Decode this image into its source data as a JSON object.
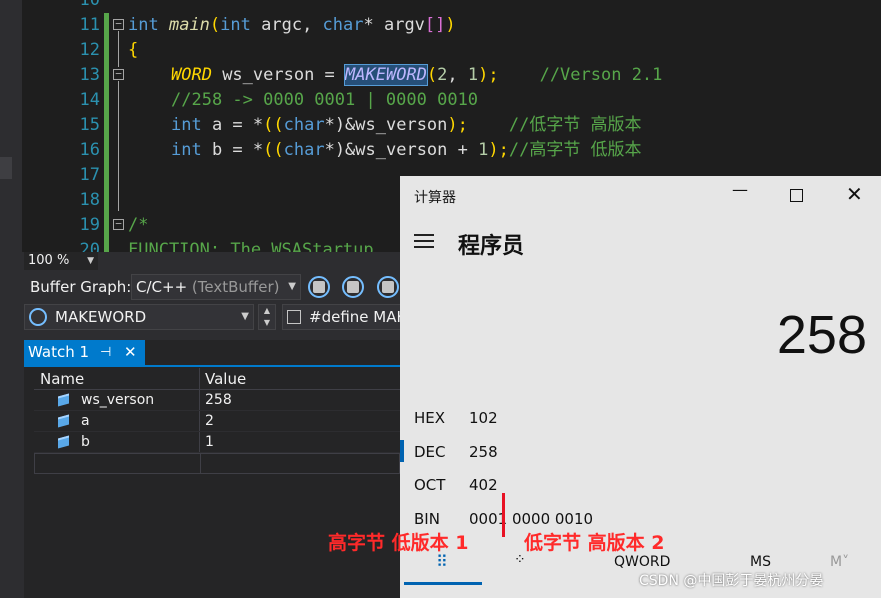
{
  "editor": {
    "lines": [
      {
        "num": "10"
      },
      {
        "num": "11"
      },
      {
        "num": "12"
      },
      {
        "num": "13"
      },
      {
        "num": "14"
      },
      {
        "num": "15"
      },
      {
        "num": "16"
      },
      {
        "num": "17"
      },
      {
        "num": "18"
      },
      {
        "num": "19"
      },
      {
        "num": "20"
      }
    ],
    "code": {
      "l11_int": "int",
      "l11_main": "main",
      "l11_rest1": "(",
      "l11_int2": "int",
      "l11_argc": " argc, ",
      "l11_char": "char",
      "l11_argv": "* argv",
      "l11_brk": "[]",
      "l11_close": ")",
      "l12": "{",
      "l13_word": "WORD",
      "l13_var": " ws_verson = ",
      "l13_macro": "MAKEWORD",
      "l13_args_open": "(",
      "l13_n1": "2",
      "l13_comma": ", ",
      "l13_n2": "1",
      "l13_args_close": ");",
      "l13_cm": "//Verson 2.1",
      "l14_cm": "//258 -> 0000 0001 | 0000 0010",
      "l15_int": "int",
      "l15_a": " a = *",
      "l15_p1": "((",
      "l15_char": "char",
      "l15_mid": "*)&ws_verson",
      "l15_p2": ");",
      "l15_cm": "//低字节 高版本",
      "l16_int": "int",
      "l16_b": " b = *",
      "l16_p1": "((",
      "l16_char": "char",
      "l16_mid": "*)&ws_verson + ",
      "l16_n": "1",
      "l16_p2": ");",
      "l16_cm": "//高字节 低版本",
      "l19_cm": "/*",
      "l20_cm": "FUNCTION: The WSAStartup"
    }
  },
  "toolbar": {
    "zoom": "100 %",
    "buffer_graph_label": "Buffer Graph:",
    "buffer_graph_value": "C/C++",
    "buffer_graph_hint": "(TextBuffer)",
    "nav_symbol": "MAKEWORD",
    "nav_define": "#define MAKE"
  },
  "watch": {
    "tab_label": "Watch 1",
    "pin_icon": "pin-icon",
    "close_icon": "close-icon",
    "col_name": "Name",
    "col_value": "Value",
    "rows": [
      {
        "name": "ws_verson",
        "value": "258"
      },
      {
        "name": "a",
        "value": "2"
      },
      {
        "name": "b",
        "value": "1"
      }
    ]
  },
  "calculator": {
    "title": "计算器",
    "mode": "程序员",
    "display": "258",
    "bases": [
      {
        "label": "HEX",
        "value": "102"
      },
      {
        "label": "DEC",
        "value": "258"
      },
      {
        "label": "OCT",
        "value": "402"
      },
      {
        "label": "BIN",
        "value": "0001 0000 0010"
      }
    ],
    "tabs": {
      "qword": "QWORD",
      "ms": "MS",
      "mplus": "M˅"
    },
    "accent": "#0063b1"
  },
  "annotations": {
    "left": "高字节 低版本 1",
    "right": "低字节 高版本 2",
    "color": "#ff2a2a"
  },
  "watermark": "CSDN @中国彭于晏杭州分晏"
}
